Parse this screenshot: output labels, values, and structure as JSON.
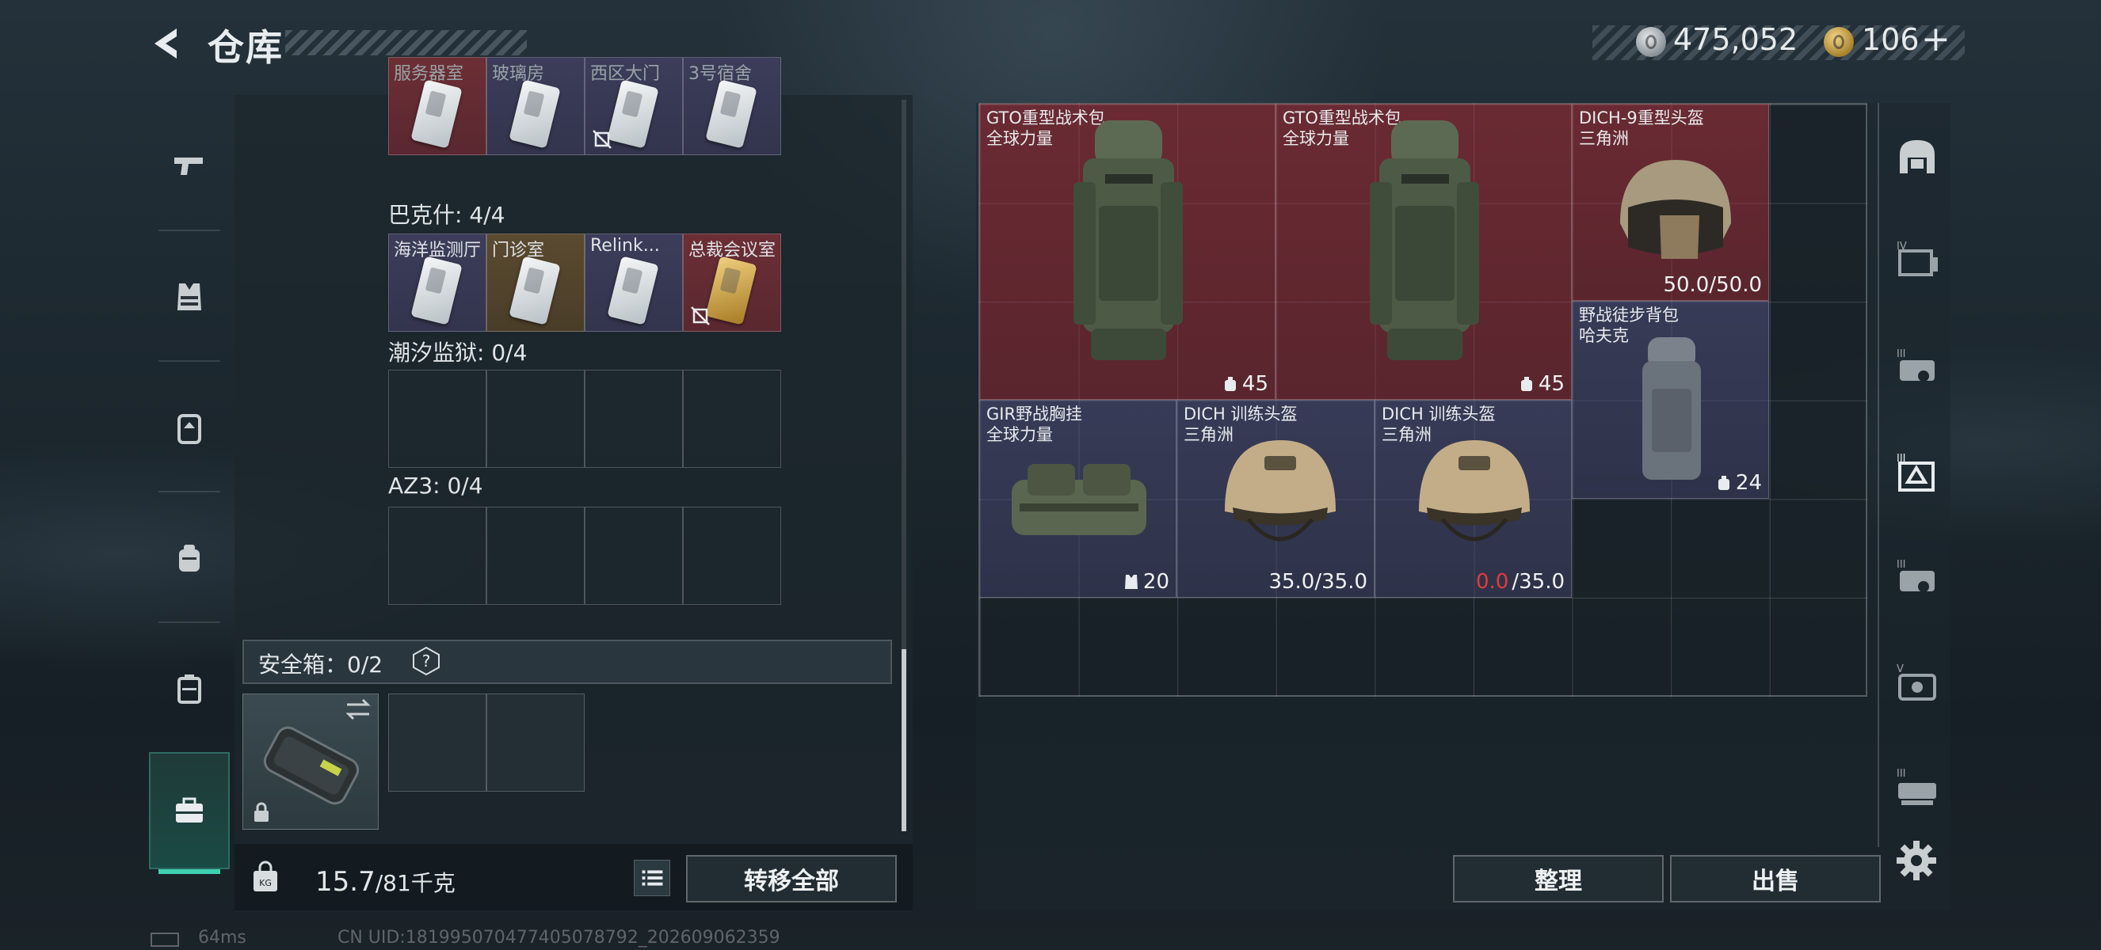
{
  "header": {
    "title": "仓库",
    "currency_silver": "475,052",
    "currency_gold": "106",
    "plus_label": "+"
  },
  "left_panel": {
    "top_row_keys": [
      {
        "name": "服务器室",
        "tone": "red",
        "card": "silver"
      },
      {
        "name": "玻璃房",
        "tone": "purple",
        "card": "silver"
      },
      {
        "name": "西区大门",
        "tone": "purple",
        "card": "silver",
        "no_extract": true
      },
      {
        "name": "3号宿舍",
        "tone": "purple",
        "card": "silver"
      }
    ],
    "section_bakesh": "巴克什: 4/4",
    "bakesh_keys": [
      {
        "name": "海洋监测厅",
        "tone": "purple",
        "card": "silver"
      },
      {
        "name": "门诊室",
        "tone": "gold",
        "card": "silver"
      },
      {
        "name": "Relink...",
        "tone": "purple",
        "card": "silver"
      },
      {
        "name": "总裁会议室",
        "tone": "red",
        "card": "gold",
        "no_extract": true
      }
    ],
    "section_prison": "潮汐监狱: 0/4",
    "section_az3": "AZ3: 0/4",
    "safe_box_label": "安全箱：0/2",
    "help_label": "?",
    "weight_current": "15.7",
    "weight_max": "/81千克",
    "transfer_all": "转移全部"
  },
  "stash": {
    "items": [
      {
        "name": "GTO重型战术包",
        "sub": "全球力量",
        "value": "45",
        "tone": "red",
        "kind": "backpack"
      },
      {
        "name": "GTO重型战术包",
        "sub": "全球力量",
        "value": "45",
        "tone": "red",
        "kind": "backpack"
      },
      {
        "name": "DICH-9重型头盔",
        "sub": "三角洲",
        "value": "50.0/50.0",
        "tone": "red",
        "kind": "helmet"
      },
      {
        "name": "野战徒步背包",
        "sub": "哈夫克",
        "value": "24",
        "tone": "purple",
        "kind": "backpack-small"
      },
      {
        "name": "GIR野战胸挂",
        "sub": "全球力量",
        "value": "20",
        "tone": "purple",
        "kind": "vest"
      },
      {
        "name": "DICH 训练头盔",
        "sub": "三角洲",
        "value": "35.0/35.0",
        "tone": "purple",
        "kind": "helmet"
      },
      {
        "name": "DICH 训练头盔",
        "sub": "三角洲",
        "value_current": "0.0",
        "value_max": "/35.0",
        "tone": "purple",
        "kind": "helmet"
      }
    ],
    "sort_label": "整理",
    "sell_label": "出售"
  },
  "status_bar": {
    "ping": "64ms",
    "uid": "CN UID:1819950704774050787​92_202609062359"
  },
  "colors": {
    "accent": "#3fd0b2",
    "rarity_red": "#6a2a33",
    "rarity_purple": "#373b57",
    "rarity_gold": "#5a4a30",
    "durability_zero": "#e23b3b"
  },
  "icons": {
    "back": "chevron-left-icon",
    "nav": [
      "pistol-icon",
      "vest-icon",
      "backpack-icon",
      "backpack-plus-icon",
      "case-icon",
      "toolbox-icon"
    ],
    "right_tabs": [
      "helmet-frame-icon",
      "folder-iv-icon",
      "gear-iii-icon",
      "frame-iii-icon",
      "gear-iii-icon",
      "frame-v-icon",
      "tank-iii-icon"
    ]
  }
}
